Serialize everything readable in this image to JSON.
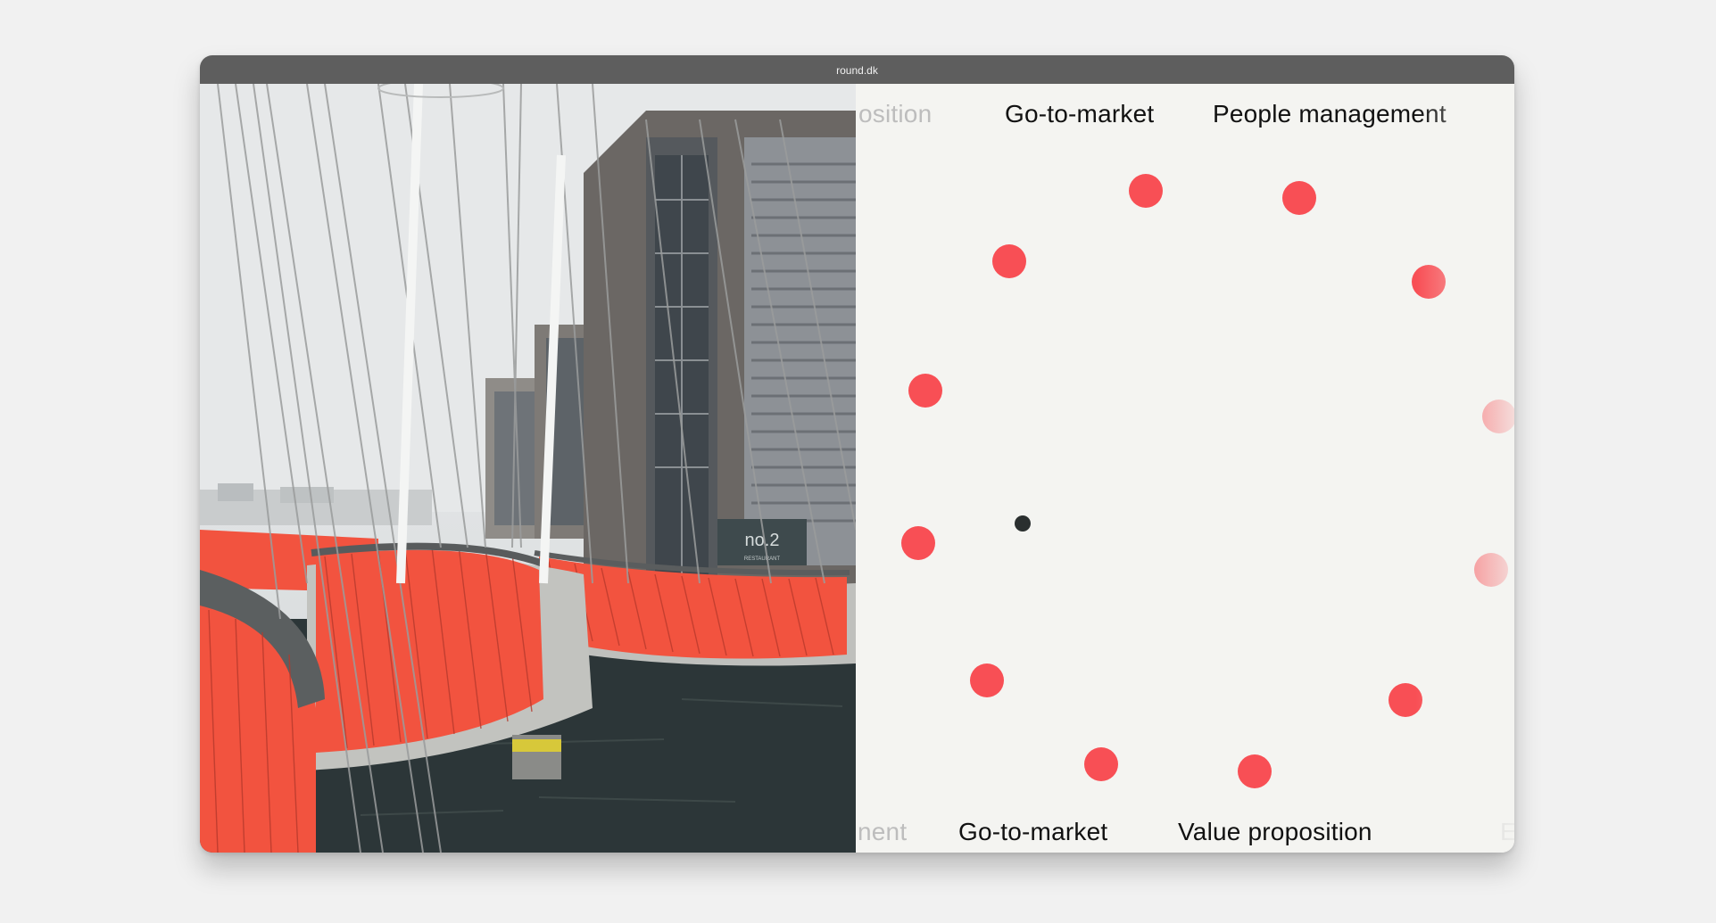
{
  "window": {
    "url": "round.dk"
  },
  "photo": {
    "sign_text": "no.2",
    "sign_subtext": "RESTAURANT"
  },
  "topics_top": [
    "osition",
    "Go-to-market",
    "People management"
  ],
  "topics_bottom": [
    "nent",
    "Go-to-market",
    "Value proposition",
    "E"
  ],
  "colors": {
    "dot": "#f84f55",
    "center_dot": "#2a2f2f",
    "titlebar": "#5e5e5e",
    "panel_bg": "#f4f4f1",
    "railing": "#f2533f"
  }
}
